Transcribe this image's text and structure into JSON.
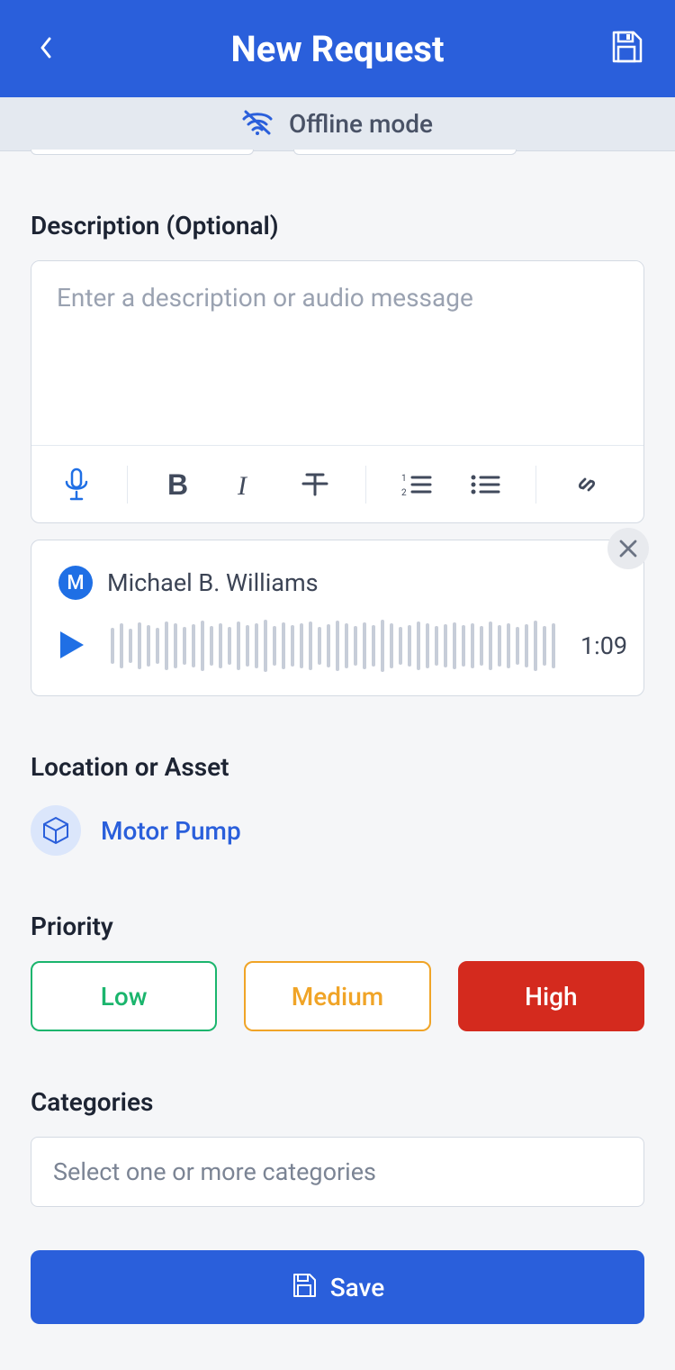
{
  "header": {
    "title": "New Request"
  },
  "offline": {
    "label": "Offline mode"
  },
  "description": {
    "label": "Description (Optional)",
    "placeholder": "Enter a description or audio message",
    "value": ""
  },
  "audio": {
    "avatar_initial": "M",
    "author": "Michael B. Williams",
    "duration": "1:09"
  },
  "location": {
    "label": "Location or Asset",
    "asset": "Motor Pump"
  },
  "priority": {
    "label": "Priority",
    "options": {
      "low": "Low",
      "medium": "Medium",
      "high": "High"
    },
    "selected": "High"
  },
  "categories": {
    "label": "Categories",
    "placeholder": "Select one or more categories",
    "value": ""
  },
  "save": {
    "label": "Save"
  }
}
